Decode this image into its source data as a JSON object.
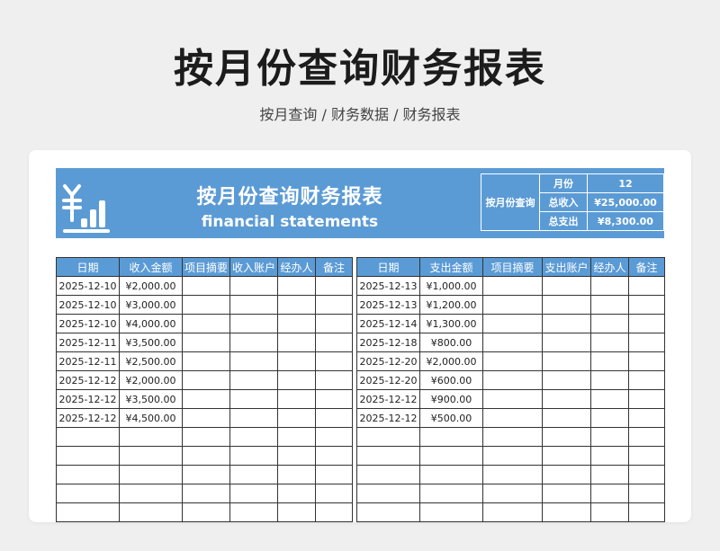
{
  "page": {
    "title": "按月份查询财务报表",
    "subtitle": "按月查询 / 财务数据 / 财务报表"
  },
  "banner": {
    "title": "按月份查询财务报表",
    "subtitle": "financial statements",
    "icon": "yen-bar-chart-icon"
  },
  "summary": {
    "label": "按月份查询",
    "month_label": "月份",
    "month_value": "12",
    "income_label": "总收入",
    "income_value": "¥25,000.00",
    "expense_label": "总支出",
    "expense_value": "¥8,300.00"
  },
  "income_table": {
    "headers": [
      "日期",
      "收入金额",
      "项目摘要",
      "收入账户",
      "经办人",
      "备注"
    ],
    "rows": [
      [
        "2025-12-10",
        "¥2,000.00",
        "",
        "",
        "",
        ""
      ],
      [
        "2025-12-10",
        "¥3,000.00",
        "",
        "",
        "",
        ""
      ],
      [
        "2025-12-10",
        "¥4,000.00",
        "",
        "",
        "",
        ""
      ],
      [
        "2025-12-11",
        "¥3,500.00",
        "",
        "",
        "",
        ""
      ],
      [
        "2025-12-11",
        "¥2,500.00",
        "",
        "",
        "",
        ""
      ],
      [
        "2025-12-12",
        "¥2,000.00",
        "",
        "",
        "",
        ""
      ],
      [
        "2025-12-12",
        "¥3,500.00",
        "",
        "",
        "",
        ""
      ],
      [
        "2025-12-12",
        "¥4,500.00",
        "",
        "",
        "",
        ""
      ],
      [
        "",
        "",
        "",
        "",
        "",
        ""
      ],
      [
        "",
        "",
        "",
        "",
        "",
        ""
      ],
      [
        "",
        "",
        "",
        "",
        "",
        ""
      ],
      [
        "",
        "",
        "",
        "",
        "",
        ""
      ],
      [
        "",
        "",
        "",
        "",
        "",
        ""
      ]
    ]
  },
  "expense_table": {
    "headers": [
      "日期",
      "支出金额",
      "项目摘要",
      "支出账户",
      "经办人",
      "备注"
    ],
    "rows": [
      [
        "2025-12-13",
        "¥1,000.00",
        "",
        "",
        "",
        ""
      ],
      [
        "2025-12-13",
        "¥1,200.00",
        "",
        "",
        "",
        ""
      ],
      [
        "2025-12-14",
        "¥1,300.00",
        "",
        "",
        "",
        ""
      ],
      [
        "2025-12-18",
        "¥800.00",
        "",
        "",
        "",
        ""
      ],
      [
        "2025-12-20",
        "¥2,000.00",
        "",
        "",
        "",
        ""
      ],
      [
        "2025-12-20",
        "¥600.00",
        "",
        "",
        "",
        ""
      ],
      [
        "2025-12-12",
        "¥900.00",
        "",
        "",
        "",
        ""
      ],
      [
        "2025-12-12",
        "¥500.00",
        "",
        "",
        "",
        ""
      ],
      [
        "",
        "",
        "",
        "",
        "",
        ""
      ],
      [
        "",
        "",
        "",
        "",
        "",
        ""
      ],
      [
        "",
        "",
        "",
        "",
        "",
        ""
      ],
      [
        "",
        "",
        "",
        "",
        "",
        ""
      ],
      [
        "",
        "",
        "",
        "",
        "",
        ""
      ]
    ]
  },
  "colors": {
    "accent": "#5b9bd5",
    "background": "#efefef",
    "card": "#ffffff"
  }
}
